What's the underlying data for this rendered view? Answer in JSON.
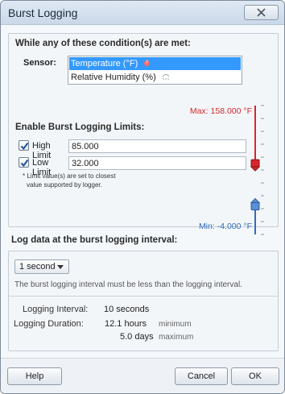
{
  "window": {
    "title": "Burst Logging",
    "close_label": "☒"
  },
  "conditions": {
    "heading": "While any of these condition(s) are met:",
    "sensor_label": "Sensor:",
    "sensors": [
      {
        "label": "Temperature (°F)",
        "selected": true,
        "icon": "thermometer-icon"
      },
      {
        "label": "Relative Humidity (%)",
        "selected": false,
        "icon": "humidity-icon"
      }
    ]
  },
  "limits": {
    "heading": "Enable Burst Logging Limits:",
    "max_label": "Max: 158.000 °F",
    "min_label": "Min: -4.000 °F",
    "high": {
      "label": "High Limit",
      "value": "85.000",
      "checked": true
    },
    "low": {
      "label": "Low Limit",
      "value": "32.000",
      "checked": true
    },
    "note_line1": "* Limit value(s) are set to closest",
    "note_line2": "value supported by logger.",
    "range_min": -4,
    "range_max": 158,
    "colors": {
      "max": "#d6272c",
      "min": "#2f6fbd"
    }
  },
  "interval": {
    "heading": "Log data at the burst logging interval:",
    "selected": "1 second",
    "hint": "The burst logging interval must be less than the logging interval.",
    "logging_interval_label": "Logging Interval:",
    "logging_interval_value": "10 seconds",
    "logging_duration_label": "Logging Duration:",
    "duration_min_value": "12.1 hours",
    "duration_min_unit": "minimum",
    "duration_max_value": "5.0 days",
    "duration_max_unit": "maximum"
  },
  "buttons": {
    "help": "Help",
    "cancel": "Cancel",
    "ok": "OK"
  }
}
